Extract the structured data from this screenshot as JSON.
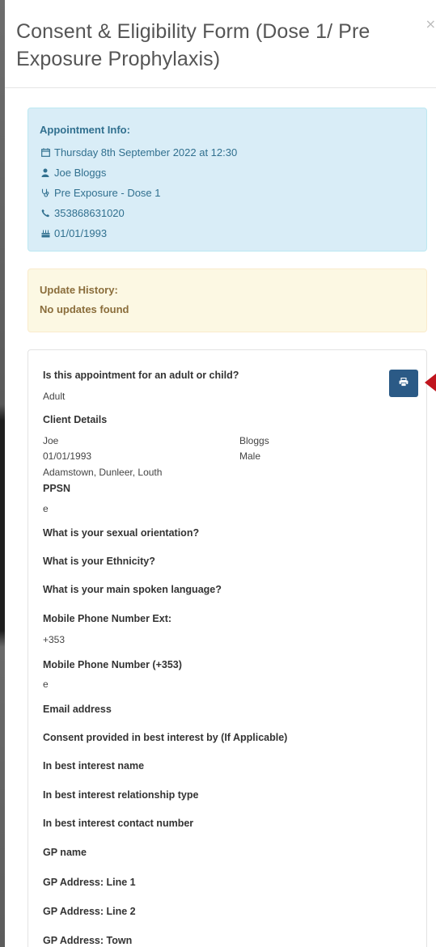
{
  "modal": {
    "title": "Consent & Eligibility Form (Dose 1/ Pre Exposure Prophylaxis)",
    "close_label": "×"
  },
  "appointment_info": {
    "heading": "Appointment Info:",
    "datetime": "Thursday 8th September 2022 at 12:30",
    "name": "Joe Bloggs",
    "appointment_type": "Pre Exposure - Dose 1",
    "phone": "353868631020",
    "dob": "01/01/1993"
  },
  "update_history": {
    "heading": "Update History:",
    "text": "No updates found"
  },
  "form": {
    "adult_child_q": "Is this appointment for an adult or child?",
    "adult_child_a": "Adult",
    "client_details_heading": "Client Details",
    "first_name": "Joe",
    "last_name": "Bloggs",
    "dob": "01/01/1993",
    "gender": "Male",
    "address": "Adamstown, Dunleer, Louth",
    "ppsn_q": "PPSN",
    "ppsn_a": "e",
    "sexual_orientation_q": "What is your sexual orientation?",
    "ethnicity_q": "What is your Ethnicity?",
    "language_q": "What is your main spoken language?",
    "mobile_ext_q": "Mobile Phone Number Ext:",
    "mobile_ext_a": "+353",
    "mobile_q": "Mobile Phone Number (+353)",
    "mobile_a": "e",
    "email_q": "Email address",
    "consent_q": "Consent provided in best interest by (If Applicable)",
    "bi_name_q": "In best interest name",
    "bi_rel_q": "In best interest relationship type",
    "bi_contact_q": "In best interest contact number",
    "gp_name_q": "GP name",
    "gp_addr1_q": "GP Address: Line 1",
    "gp_addr2_q": "GP Address: Line 2",
    "gp_town_q": "GP Address: Town"
  },
  "colors": {
    "info_bg": "#d9edf7",
    "info_text": "#31708f",
    "warn_bg": "#fcf8e3",
    "warn_text": "#8a6d3b",
    "print_button": "#2b5a86",
    "annotation_arrow": "#c0151e"
  },
  "icons": [
    "calendar-icon",
    "user-icon",
    "stethoscope-icon",
    "phone-icon",
    "birthday-cake-icon",
    "print-icon"
  ]
}
